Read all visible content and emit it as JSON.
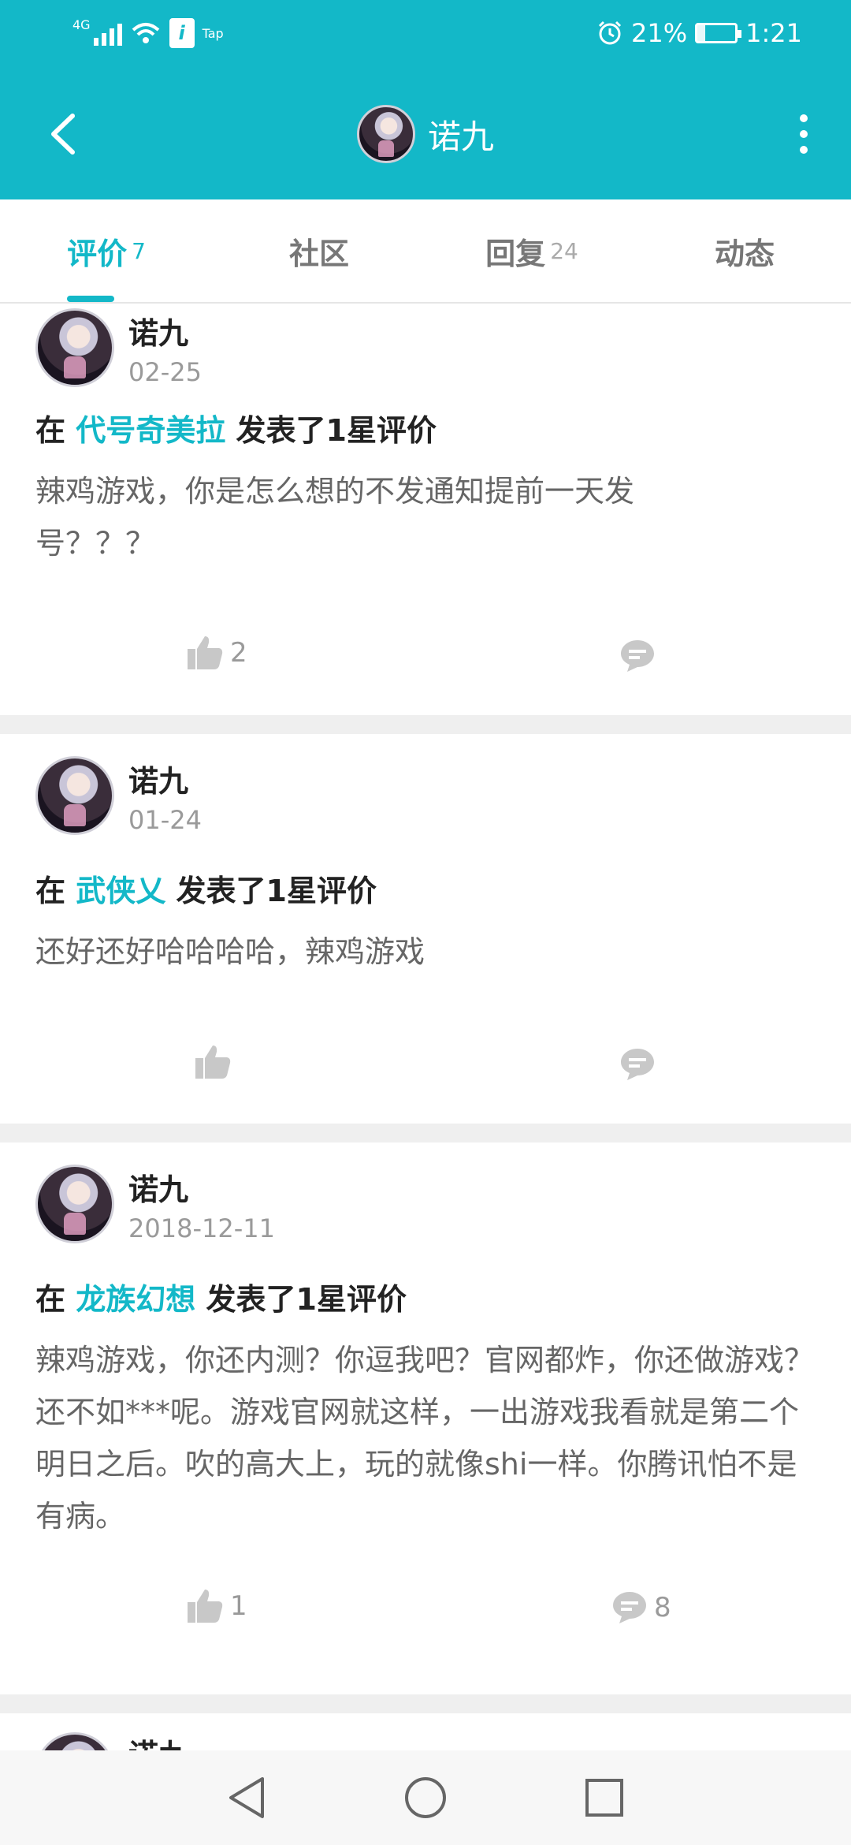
{
  "status": {
    "network": "4G",
    "app_badge": "i",
    "app_label": "Tap",
    "battery": "21%",
    "battery_level": 0.21,
    "time": "1:21"
  },
  "header": {
    "title": "诺九"
  },
  "tabs": [
    {
      "label": "评价",
      "count": "7",
      "active": true
    },
    {
      "label": "社区",
      "count": "",
      "active": false
    },
    {
      "label": "回复",
      "count": "24",
      "active": false
    },
    {
      "label": "动态",
      "count": "",
      "active": false
    }
  ],
  "reviews": [
    {
      "user": "诺九",
      "date": "02-25",
      "prefix": "在",
      "game": "代号奇美拉",
      "suffix": "发表了1星评价",
      "content": "辣鸡游戏，你是怎么想的不发通知提前一天发号？？？",
      "likes": "2",
      "comments": ""
    },
    {
      "user": "诺九",
      "date": "01-24",
      "prefix": "在",
      "game": "武侠乂",
      "suffix": "发表了1星评价",
      "content": "还好还好哈哈哈哈，辣鸡游戏",
      "likes": "",
      "comments": ""
    },
    {
      "user": "诺九",
      "date": "2018-12-11",
      "prefix": "在",
      "game": "龙族幻想",
      "suffix": "发表了1星评价",
      "content": "辣鸡游戏，你还内测？你逗我吧？官网都炸，你还做游戏？还不如***呢。游戏官网就这样，一出游戏我看就是第二个明日之后。吹的高大上，玩的就像shi一样。你腾讯怕不是有病。",
      "likes": "1",
      "comments": "8"
    }
  ],
  "peek": {
    "user": "诺九"
  },
  "icons": {
    "back": "back-arrow-icon",
    "more": "more-vertical-icon",
    "like": "thumbs-up-icon",
    "comment": "comment-bubble-icon",
    "nav_back": "triangle-back-icon",
    "nav_home": "circle-home-icon",
    "nav_recent": "square-recent-icon"
  },
  "colors": {
    "accent": "#13b8c8",
    "icon_gray": "#c8c8c8"
  }
}
